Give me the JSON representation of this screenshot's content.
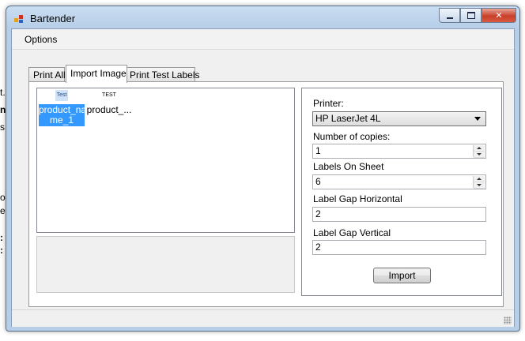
{
  "window": {
    "title": "Bartender"
  },
  "menu": {
    "options": "Options"
  },
  "tabs": [
    {
      "label": "Print All"
    },
    {
      "label": "Import Image"
    },
    {
      "label": "Print Test Labels"
    }
  ],
  "images": [
    {
      "icon_text": "Test",
      "label": "product_na\nme_1",
      "selected": true
    },
    {
      "icon_text": "TEST",
      "label": "product_...",
      "selected": false
    }
  ],
  "settings": {
    "printer_label": "Printer:",
    "printer_value": "HP LaserJet 4L",
    "copies_label": "Number of copies:",
    "copies_value": "1",
    "labels_label": "Labels On Sheet",
    "labels_value": "6",
    "gap_h_label": "Label Gap Horizontal",
    "gap_h_value": "2",
    "gap_v_label": "Label Gap Vertical",
    "gap_v_value": "2",
    "import_button": "Import"
  },
  "background_fragments": [
    "t.",
    "n",
    "s@",
    "o",
    "e",
    ":",
    ":"
  ]
}
